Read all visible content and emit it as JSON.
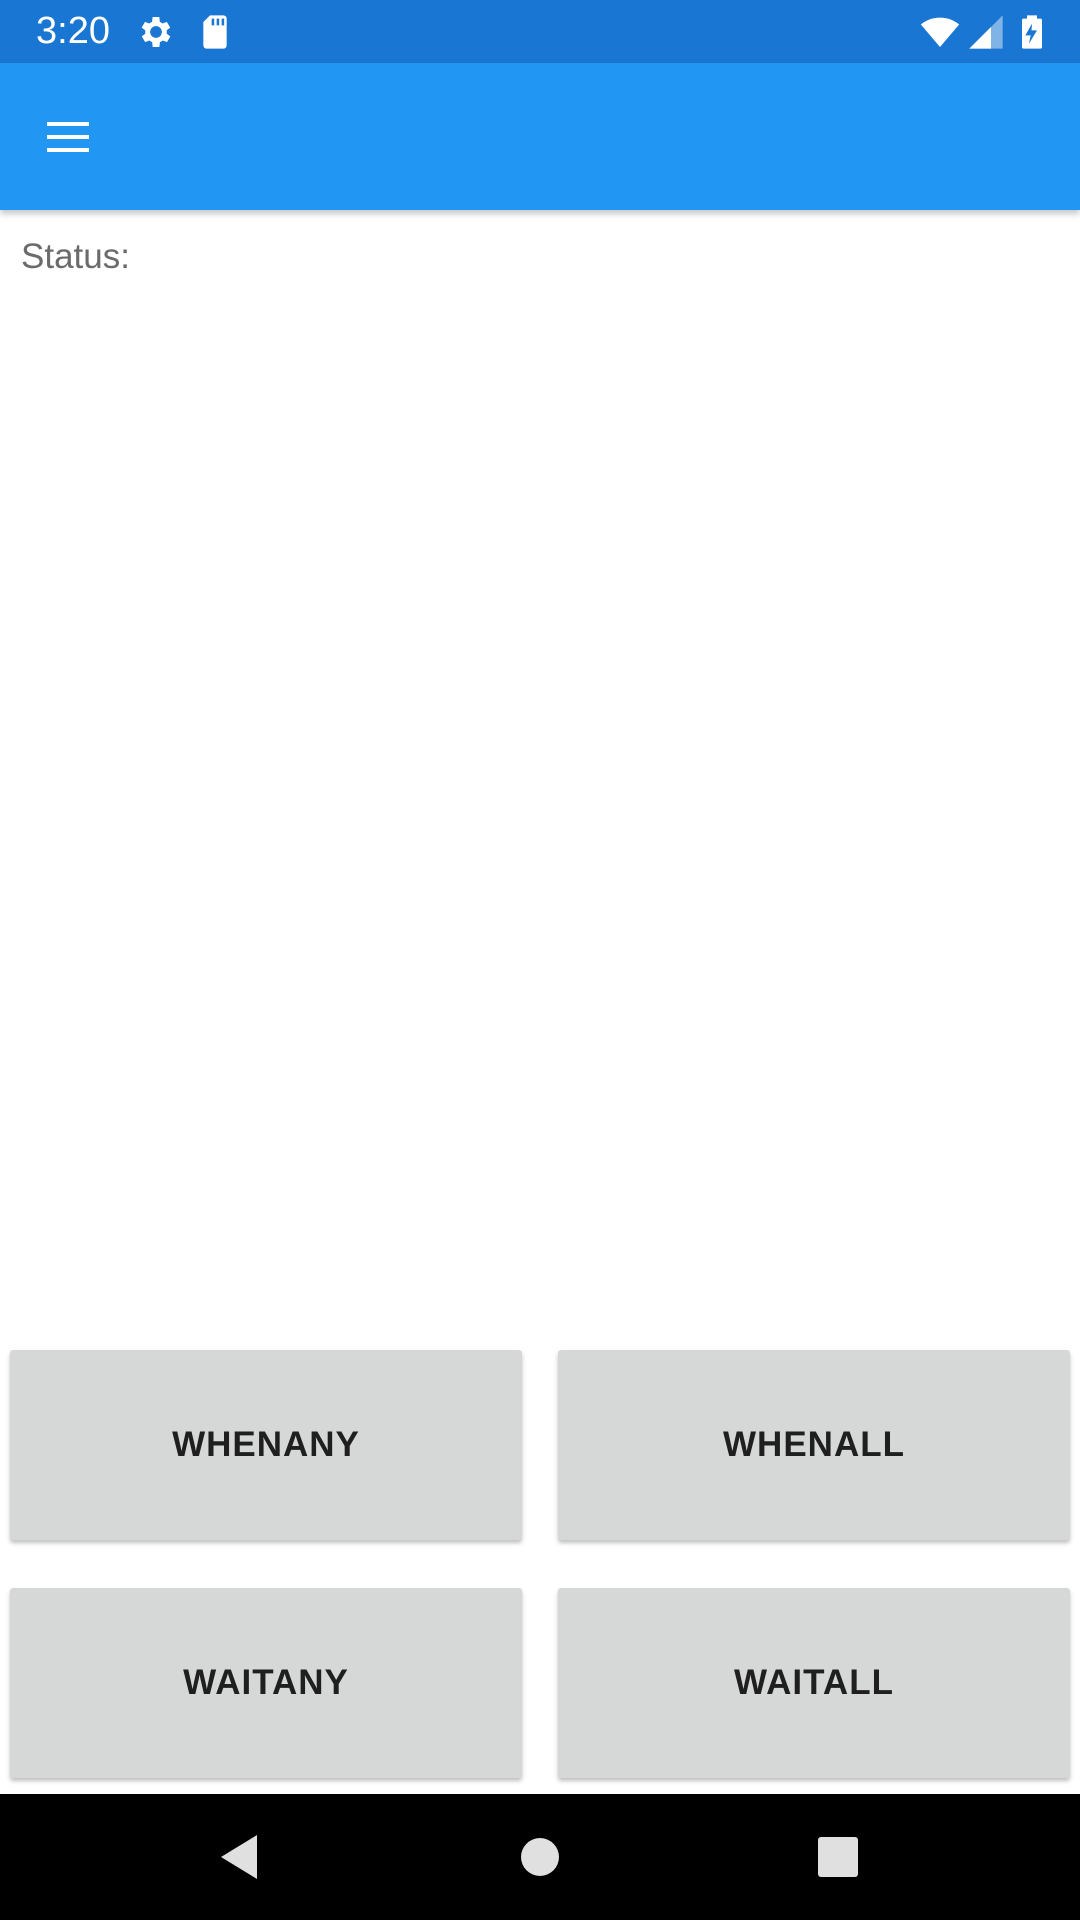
{
  "status_bar": {
    "time": "3:20",
    "icons": [
      "settings-gear-icon",
      "sd-card-icon",
      "wifi-icon",
      "cell-signal-icon",
      "battery-charging-icon"
    ]
  },
  "app_bar": {
    "menu_icon": "hamburger-menu-icon"
  },
  "content": {
    "status_label": "Status:"
  },
  "buttons": [
    {
      "label": "WHENANY"
    },
    {
      "label": "WHENALL"
    },
    {
      "label": "WAITANY"
    },
    {
      "label": "WAITALL"
    }
  ],
  "nav_bar": {
    "icons": [
      "back-icon",
      "home-icon",
      "recents-icon"
    ]
  },
  "colors": {
    "status_bar": "#1976d2",
    "app_bar": "#2196f3",
    "button_bg": "#d6d7d7",
    "nav_bar": "#000000"
  }
}
